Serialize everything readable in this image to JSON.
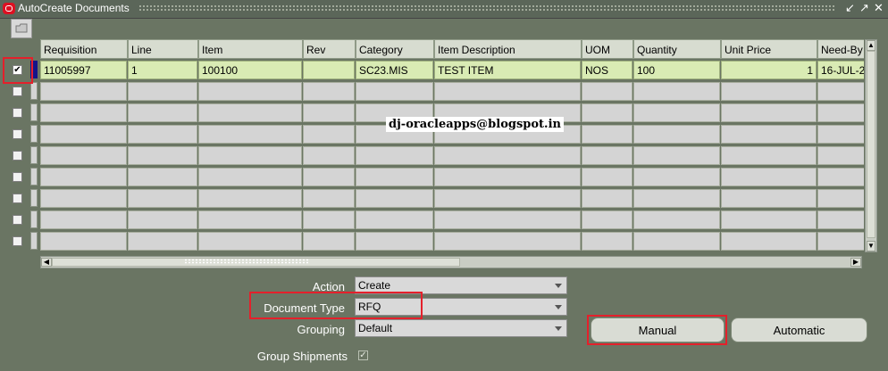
{
  "window": {
    "title": "AutoCreate Documents"
  },
  "grid": {
    "columns": [
      "Requisition",
      "Line",
      "Item",
      "Rev",
      "Category",
      "Item Description",
      "UOM",
      "Quantity",
      "Unit Price",
      "Need-By"
    ],
    "rows": [
      {
        "selected": true,
        "cells": [
          "11005997",
          "1",
          "100100",
          "",
          "SC23.MIS",
          "TEST ITEM",
          "NOS",
          "100",
          "1",
          "16-JUL-2"
        ]
      }
    ]
  },
  "watermark": "dj-oracleapps@blogspot.in",
  "form": {
    "action": {
      "label": "Action",
      "value": "Create"
    },
    "document_type": {
      "label": "Document Type",
      "value": "RFQ"
    },
    "grouping": {
      "label": "Grouping",
      "value": "Default"
    },
    "group_shipments": {
      "label": "Group Shipments",
      "checked": true
    }
  },
  "buttons": {
    "manual": "Manual",
    "automatic": "Automatic"
  },
  "highlight_color": "#e4202b"
}
